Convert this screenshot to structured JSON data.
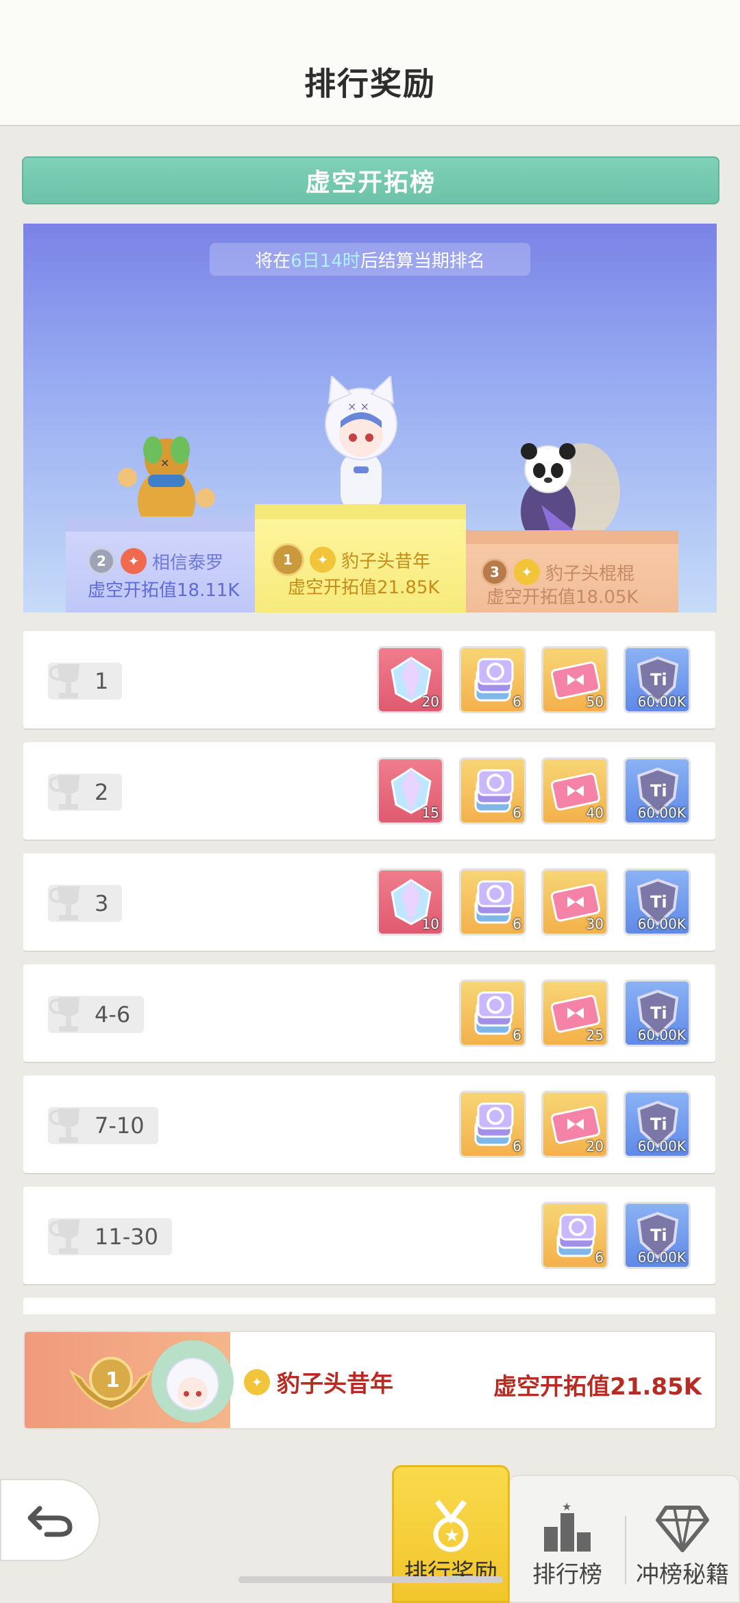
{
  "header": {
    "title": "排行奖励"
  },
  "board": {
    "title": "虚空开拓榜"
  },
  "countdown": {
    "prefix": "将在",
    "highlight": "6日14时",
    "suffix": "后结算当期排名"
  },
  "podium": {
    "first": {
      "rank": "1",
      "name": "豹子头昔年",
      "score": "虚空开拓值21.85K"
    },
    "second": {
      "rank": "2",
      "name": "相信泰罗",
      "score": "虚空开拓值18.11K"
    },
    "third": {
      "rank": "3",
      "name": "豹子头棍棍",
      "score": "虚空开拓值18.05K"
    }
  },
  "rewards": [
    {
      "rank": "1",
      "items": [
        {
          "icon": "crystal-icon",
          "color": "red",
          "qty": "20"
        },
        {
          "icon": "card-stack-icon",
          "color": "orange",
          "qty": "6"
        },
        {
          "icon": "ticket-icon",
          "color": "orange",
          "qty": "50"
        },
        {
          "icon": "shield-ti-icon",
          "color": "blue",
          "qty": "60.00K"
        }
      ]
    },
    {
      "rank": "2",
      "items": [
        {
          "icon": "crystal-icon",
          "color": "red",
          "qty": "15"
        },
        {
          "icon": "card-stack-icon",
          "color": "orange",
          "qty": "6"
        },
        {
          "icon": "ticket-icon",
          "color": "orange",
          "qty": "40"
        },
        {
          "icon": "shield-ti-icon",
          "color": "blue",
          "qty": "60.00K"
        }
      ]
    },
    {
      "rank": "3",
      "items": [
        {
          "icon": "crystal-icon",
          "color": "red",
          "qty": "10"
        },
        {
          "icon": "card-stack-icon",
          "color": "orange",
          "qty": "6"
        },
        {
          "icon": "ticket-icon",
          "color": "orange",
          "qty": "30"
        },
        {
          "icon": "shield-ti-icon",
          "color": "blue",
          "qty": "60.00K"
        }
      ]
    },
    {
      "rank": "4-6",
      "items": [
        {
          "icon": "card-stack-icon",
          "color": "orange",
          "qty": "6"
        },
        {
          "icon": "ticket-icon",
          "color": "orange",
          "qty": "25"
        },
        {
          "icon": "shield-ti-icon",
          "color": "blue",
          "qty": "60.00K"
        }
      ]
    },
    {
      "rank": "7-10",
      "items": [
        {
          "icon": "card-stack-icon",
          "color": "orange",
          "qty": "6"
        },
        {
          "icon": "ticket-icon",
          "color": "orange",
          "qty": "20"
        },
        {
          "icon": "shield-ti-icon",
          "color": "blue",
          "qty": "60.00K"
        }
      ]
    },
    {
      "rank": "11-30",
      "items": [
        {
          "icon": "card-stack-icon",
          "color": "orange",
          "qty": "6"
        },
        {
          "icon": "shield-ti-icon",
          "color": "blue",
          "qty": "60.00K"
        }
      ]
    }
  ],
  "my_rank": {
    "rank": "1",
    "name": "豹子头昔年",
    "score": "虚空开拓值21.85K"
  },
  "tabs": [
    {
      "label": "排行奖励",
      "icon": "medal-icon",
      "active": true
    },
    {
      "label": "排行榜",
      "icon": "podium-icon",
      "active": false
    },
    {
      "label": "冲榜秘籍",
      "icon": "diamond-icon",
      "active": false
    }
  ],
  "colors": {
    "accent_green": "#6cc2a8",
    "tab_active": "#f2c52c",
    "my_rank_text": "#b72b22"
  }
}
